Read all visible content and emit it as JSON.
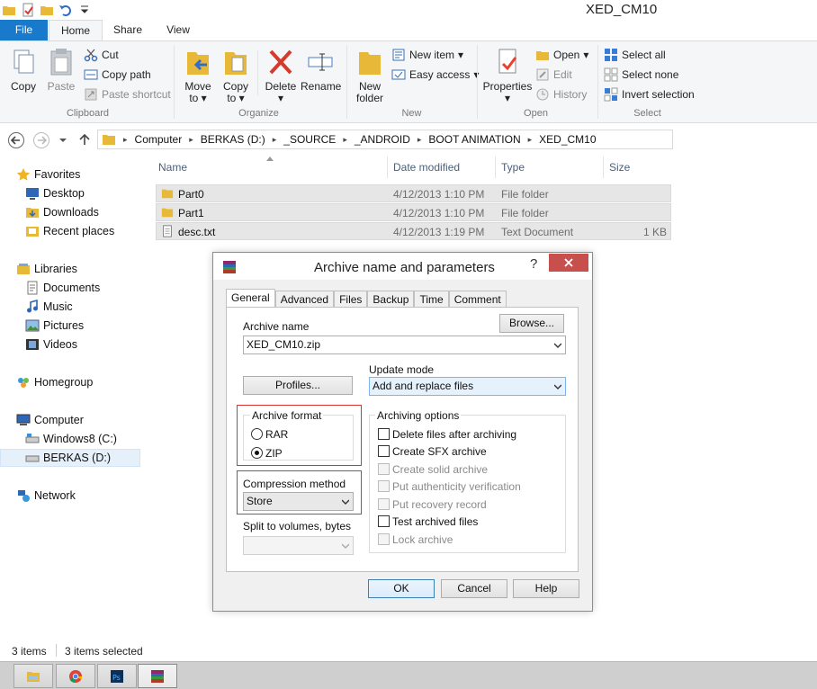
{
  "window": {
    "title": "XED_CM10"
  },
  "ribbon_tabs": {
    "file": "File",
    "home": "Home",
    "share": "Share",
    "view": "View"
  },
  "clipboard": {
    "copy": "Copy",
    "paste": "Paste",
    "cut": "Cut",
    "copy_path": "Copy path",
    "paste_shortcut": "Paste shortcut",
    "group": "Clipboard"
  },
  "organize": {
    "move_to": "Move",
    "move_to2": "to",
    "copy_to": "Copy",
    "copy_to2": "to",
    "delete": "Delete",
    "rename": "Rename",
    "group": "Organize"
  },
  "new": {
    "new_folder": "New",
    "new_folder2": "folder",
    "new_item": "New item",
    "easy_access": "Easy access",
    "group": "New"
  },
  "open": {
    "properties": "Properties",
    "open": "Open",
    "edit": "Edit",
    "history": "History",
    "group": "Open"
  },
  "select": {
    "select_all": "Select all",
    "select_none": "Select none",
    "invert": "Invert selection",
    "group": "Select"
  },
  "address": {
    "crumbs": [
      "Computer",
      "BERKAS (D:)",
      "_SOURCE",
      "_ANDROID",
      "BOOT ANIMATION",
      "XED_CM10"
    ]
  },
  "nav": {
    "favorites": "Favorites",
    "desktop": "Desktop",
    "downloads": "Downloads",
    "recent": "Recent places",
    "libraries": "Libraries",
    "documents": "Documents",
    "music": "Music",
    "pictures": "Pictures",
    "videos": "Videos",
    "homegroup": "Homegroup",
    "computer": "Computer",
    "windows8": "Windows8 (C:)",
    "berkas": "BERKAS (D:)",
    "network": "Network"
  },
  "columns": {
    "name": "Name",
    "date": "Date modified",
    "type": "Type",
    "size": "Size"
  },
  "files": [
    {
      "name": "Part0",
      "date": "4/12/2013 1:10 PM",
      "type": "File folder",
      "size": ""
    },
    {
      "name": "Part1",
      "date": "4/12/2013 1:10 PM",
      "type": "File folder",
      "size": ""
    },
    {
      "name": "desc.txt",
      "date": "4/12/2013 1:19 PM",
      "type": "Text Document",
      "size": "1 KB"
    }
  ],
  "dialog": {
    "title": "Archive name and parameters",
    "help": "?",
    "tabs": [
      "General",
      "Advanced",
      "Files",
      "Backup",
      "Time",
      "Comment"
    ],
    "archive_name_label": "Archive name",
    "browse": "Browse...",
    "archive_name": "XED_CM10.zip",
    "profiles": "Profiles...",
    "update_mode_label": "Update mode",
    "update_mode": "Add and replace files",
    "archive_format_label": "Archive format",
    "rar": "RAR",
    "zip": "ZIP",
    "compression_label": "Compression method",
    "compression": "Store",
    "split_label": "Split to volumes, bytes",
    "archiving_options_label": "Archiving options",
    "options": [
      {
        "label": "Delete files after archiving",
        "enabled": true
      },
      {
        "label": "Create SFX archive",
        "enabled": true
      },
      {
        "label": "Create solid archive",
        "enabled": false
      },
      {
        "label": "Put authenticity verification",
        "enabled": false
      },
      {
        "label": "Put recovery record",
        "enabled": false
      },
      {
        "label": "Test archived files",
        "enabled": true
      },
      {
        "label": "Lock archive",
        "enabled": false
      }
    ],
    "ok": "OK",
    "cancel": "Cancel",
    "help_btn": "Help"
  },
  "status": {
    "items": "3 items",
    "selected": "3 items selected"
  }
}
